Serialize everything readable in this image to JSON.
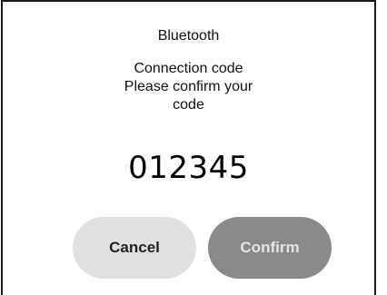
{
  "dialog": {
    "title": "Bluetooth",
    "message_lines": [
      "Connection code",
      "Please confirm your",
      "code"
    ],
    "code": "012345",
    "cancel_label": "Cancel",
    "confirm_label": "Confirm"
  },
  "colors": {
    "cancel_bg": "#e0e0e0",
    "confirm_bg": "#8a8a8a",
    "border": "#1a1a1a"
  }
}
